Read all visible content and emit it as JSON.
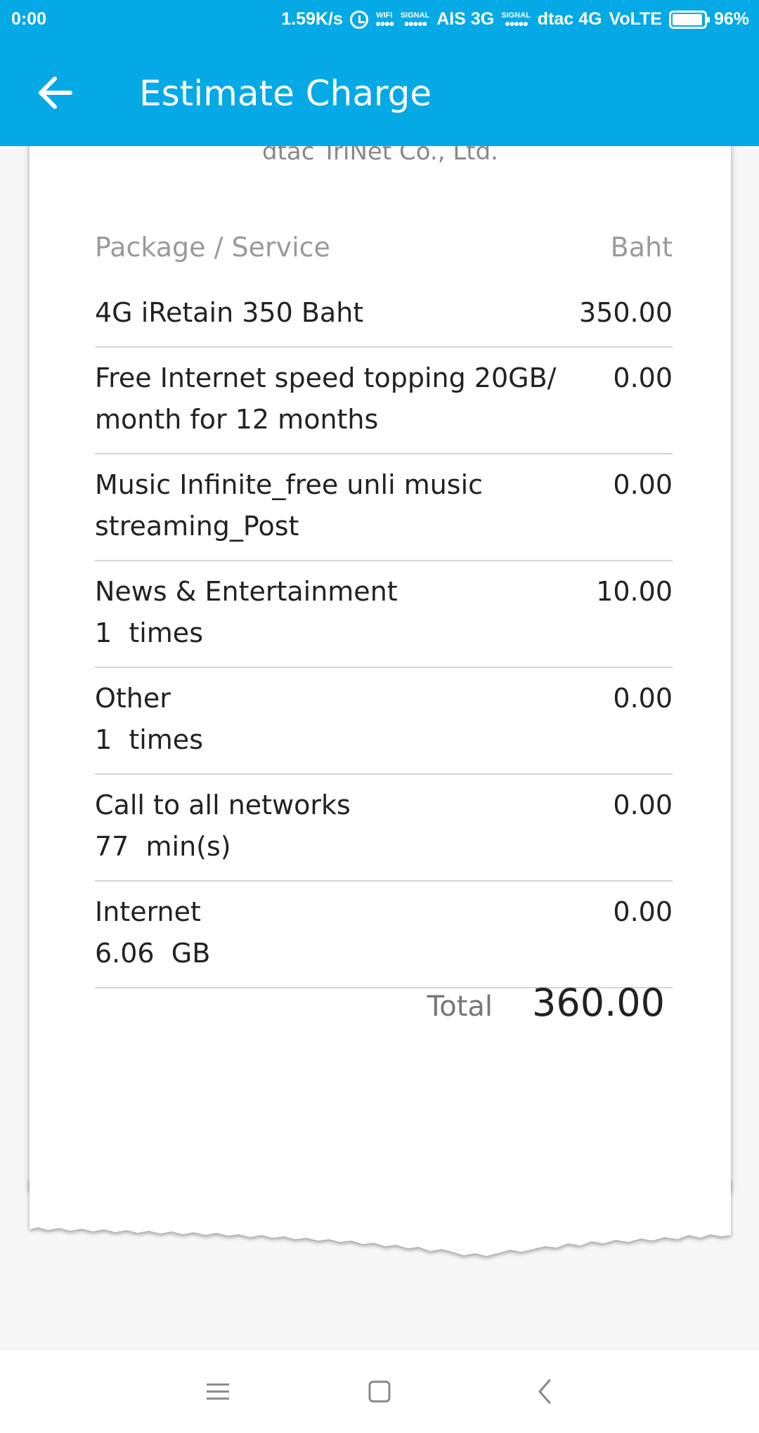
{
  "status_bar": {
    "time": "0:00",
    "net_speed": "1.59K/s",
    "wifi_label": "WIFI",
    "signal_label_1": "SIGNAL",
    "carrier_1": "AIS 3G",
    "signal_label_2": "SIGNAL",
    "carrier_2": "dtac 4G",
    "volte": "VoLTE",
    "battery": "96%"
  },
  "app_bar": {
    "title": "Estimate Charge",
    "back_icon": "arrow-left-icon"
  },
  "receipt": {
    "company": "dtac TriNet Co., Ltd.",
    "columns": {
      "service": "Package / Service",
      "amount": "Baht"
    },
    "rows": [
      {
        "service": "4G iRetain 350 Baht",
        "detail": "",
        "amount": "350.00"
      },
      {
        "service": "Free Internet speed topping 20GB/ month for 12 months",
        "detail": "",
        "amount": "0.00"
      },
      {
        "service": "Music Infinite_free unli music streaming_Post",
        "detail": "",
        "amount": "0.00"
      },
      {
        "service": "News & Entertainment",
        "detail": "1  times",
        "amount": "10.00"
      },
      {
        "service": "Other",
        "detail": "1  times",
        "amount": "0.00"
      },
      {
        "service": "Call to all networks",
        "detail": "77  min(s)",
        "amount": "0.00"
      },
      {
        "service": "Internet",
        "detail": "6.06  GB",
        "amount": "0.00"
      }
    ],
    "total_label": "Total",
    "total_value": "360.00"
  },
  "nav_bar": {
    "menu_icon": "menu-icon",
    "home_icon": "home-square-icon",
    "back_icon": "chevron-left-icon"
  },
  "colors": {
    "accent": "#04a9e6",
    "divider": "#d6d6d6",
    "muted_text": "#9a9a9a"
  }
}
